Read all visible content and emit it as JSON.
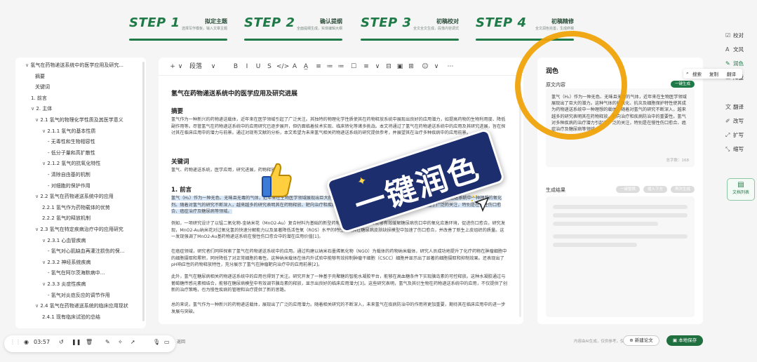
{
  "steps": [
    {
      "num": "STEP 1",
      "title": "拟定主题",
      "sub": "选择写作模板，输入文章主题"
    },
    {
      "num": "STEP 2",
      "title": "确认提纲",
      "sub": "全面提纲生成，实体编辑大纲"
    },
    {
      "num": "STEP 3",
      "title": "初稿校对",
      "sub": "全文全文生成，段落内容调式"
    },
    {
      "num": "STEP 4",
      "title": "初稿精修",
      "sub": "全文润色完善，生成终稿"
    }
  ],
  "outline": [
    {
      "level": 0,
      "chev": "∨",
      "label": "氢气在药物递送系统中的医学应用及研究..."
    },
    {
      "level": 2,
      "chev": "",
      "label": "摘要"
    },
    {
      "level": 2,
      "chev": "",
      "label": "关键词"
    },
    {
      "level": 1,
      "chev": "",
      "label": "1. 前言"
    },
    {
      "level": 1,
      "chev": "∨",
      "label": "2. 主体"
    },
    {
      "level": 2,
      "chev": "∨",
      "label": "2.1 氢气的物理化学性质及其医学意义"
    },
    {
      "level": 3,
      "chev": "∨",
      "label": "2.1.1 氢气的基本性质"
    },
    {
      "level": 4,
      "chev": "",
      "label": "- 无毒性和生物相容性"
    },
    {
      "level": 4,
      "chev": "",
      "label": "- 低分子量和高扩散性"
    },
    {
      "level": 3,
      "chev": "∨",
      "label": "2.1.2 氢气的抗氧化特性"
    },
    {
      "level": 4,
      "chev": "",
      "label": "- 清除自由基的机制"
    },
    {
      "level": 4,
      "chev": "",
      "label": "- 对细胞的保护作用"
    },
    {
      "level": 2,
      "chev": "∨",
      "label": "2.2 氢气在药物递送系统中的应用"
    },
    {
      "level": 3,
      "chev": "",
      "label": "2.2.1 氢气作为药物载体的优势"
    },
    {
      "level": 3,
      "chev": "",
      "label": "2.2.2 氢气的释放机制"
    },
    {
      "level": 2,
      "chev": "∨",
      "label": "2.3 氢气在特定疾病治疗中的应用研究"
    },
    {
      "level": 3,
      "chev": "∨",
      "label": "2.3.1 心血管疾病"
    },
    {
      "level": 4,
      "chev": "",
      "label": "- 氢气对心肌缺血再灌注损伤的保..."
    },
    {
      "level": 3,
      "chev": "∨",
      "label": "2.3.2 神经系统疾病"
    },
    {
      "level": 4,
      "chev": "",
      "label": "- 氢气在阿尔茨海默病中..."
    },
    {
      "level": 3,
      "chev": "∨",
      "label": "2.3.3 炎症性疾病"
    },
    {
      "level": 4,
      "chev": "",
      "label": "- 氢气对炎症反应的调节作用"
    },
    {
      "level": 2,
      "chev": "∨",
      "label": "2.4 氢气在药物递送系统的临床应用现状"
    },
    {
      "level": 3,
      "chev": "",
      "label": "2.4.1 现有临床试验的总结"
    }
  ],
  "toolbar": {
    "items": [
      "+",
      "∨",
      "段落",
      "∨",
      "B",
      "I",
      "U",
      "S",
      "</>",
      "A",
      "A̲",
      "≡",
      "≔",
      "≔",
      "☐",
      "≡",
      "∨",
      "⊟",
      "▣",
      "⊞",
      "☺",
      "∨",
      "⋯"
    ]
  },
  "doc": {
    "title": "氢气在药物递送系统中的医学应用及研究进展",
    "abstract_h": "摘要",
    "abstract": "氢气作为一种新兴的药物递送载体，近年来在医学领域引起了广泛关注。其独特的物理化学性质使其在药物释放系统中展现出良好的应用潜力，如提高药物的生物利用度、降低副作用等。尽管氢气在药物递送系统中的应用研究已逐步展开，但仍面临着技术实现、临床转化等诸多挑战。本文将通过了氢气在药物递送系统中的应用及其研究进展，旨在探讨其在临床应用中的潜力与前景。通过对现有文献的分析，本文希望为未来氢气相关药物递送系统的研究提供参考，并展望其在治疗多种疾病中的应用前景。",
    "keywords_h": "关键词",
    "keywords": "氢气、药物递送系统，医学应用，研究进展，药物释放",
    "intro_h": "1. 前言",
    "intro_hl": "氢气（H₂）作为一种无色、无味且无毒的气体，近年来在生物医学领域展现出巨大的潜力。这种气体的抗氧化、抗炎及细胞保护特性使其成为药物递送系统中一种理想的氧化剂。随着对氢气的研究不断深入，越来越多的研究表明其在药物释放、靶向治疗和疾病防治中的重要性。氢气对多种疾病的治疗潜力引起了广泛的关注，特别是在慢性伤口愈合、癌症治疗及糖尿病等领域。",
    "p2": "例如，一项研究设计了以锰二氧化物-金纳米花（MnO2-Au）复合材料为基础的新型药物递送平台，该平台能够有效缓解糖尿病伤口中的氧化应激环境，促进伤口愈合。研究发现，MnO2-Au纳米花对过氧化氢的快速分解能力以及显著降低活性氧（ROS）水平的特性，使其在糖尿病皮肤缺损模型中加速了伤口愈合，并改善了新生上皮组织的质量。这一发现强调了MnO2-Au基药物递送系统在慢性伤口愈合中的潜在应用价值[1]。",
    "p3": "在癌症领域，研究者们同样探索了氢气在药物递送系统中的应用。通过构建以纳米石墨烯氧化物（NGO）为载体的药物纳米载体，研究人员成功地提升了化疗药物在肿瘤细胞中的细胞摄取和累积，同时降低了对正常细胞的毒性。这种纳米载体在体内外试验中能够有效抑制肿瘤干细胞（CSCC）细胞并显示出了显著的细胞摄取和抑制效果。还表现出了pH响应性的药物释放特性，充分展示了氢气在肿瘤靶向治疗中的应用前景[2]。",
    "p4": "此外，氢气在糖尿病相关药物递送系统中的应用也得到了关注。研究开发了一种基于壳聚糖的智能水凝胶平台，能够在高血糖条件下实现胰岛素的可控释放。这种水凝胶通过与葡萄糖传感元素相结合，能够在糖尿病模型中有效调节胰岛素的释放，显示出良好的临床应用潜力[3]。这些研究表明，氢气及其衍生物在药物递送系统中的应用，不仅提供了创新的治疗策略，也为慢性疾病的管理和治疗提供了新的思路。",
    "p5": "总的来说，氢气作为一种新兴的药物递送载体，展现出了广泛的应用潜力。随着相关研究的不断深入，未来氢气在疾病防治中的作用将更加重要，期待其在临床应用中的进一步发展与突破。"
  },
  "panel": {
    "title": "润色",
    "source_label": "原文内容",
    "source_btn": "一键生成",
    "source_text": "氢气（H₂）作为一种无色、无味且无毒的气体，近年来在生物医学领域展现出了巨大的潜力。这种气体的抗氧化、抗炎及细胞保护特性使其成为药物递送系统中一种理想的载体。随着对氢气的研究不断深入，越来越多的研究表明其在药物释放、靶向治疗和疾病防治中的重要性。氢气对多种疾病的治疗潜力引起了广泛的关注，特别是在慢性伤口愈合、癌症治疗及糖尿病等领域。",
    "count": "总字数：168",
    "result_label": "生成结果",
    "result_btns": [
      "一键替换",
      "插入下方",
      "再次生成"
    ]
  },
  "context_menu": [
    "搜索",
    "复制",
    "翻译"
  ],
  "tools": [
    {
      "icon": "☑",
      "label": "校对",
      "active": false
    },
    {
      "icon": "A",
      "label": "文风",
      "active": false
    },
    {
      "icon": "✎",
      "label": "润色",
      "active": true
    },
    {
      "icon": "▭",
      "label": "降重",
      "active": false
    },
    {
      "icon": "文",
      "label": "翻译",
      "active": false
    },
    {
      "icon": "✐",
      "label": "改写",
      "active": false
    },
    {
      "icon": "⤢",
      "label": "扩写",
      "active": false
    },
    {
      "icon": "⤡",
      "label": "缩写",
      "active": false
    }
  ],
  "doclist": "文档列表",
  "recbar": {
    "time": "03:57"
  },
  "bottom": {
    "hint": "内容由AI生成，仅供参考，仅供参考",
    "left_hint": "返回",
    "new_btn": "新建论文",
    "save_btn": "本地保存"
  },
  "overlay": {
    "banner": "一键润色"
  },
  "colors": {
    "brand": "#1f7a47",
    "highlight": "#d8e7f8",
    "ring": "#f0a30a",
    "banner": "#1d2e6f"
  }
}
